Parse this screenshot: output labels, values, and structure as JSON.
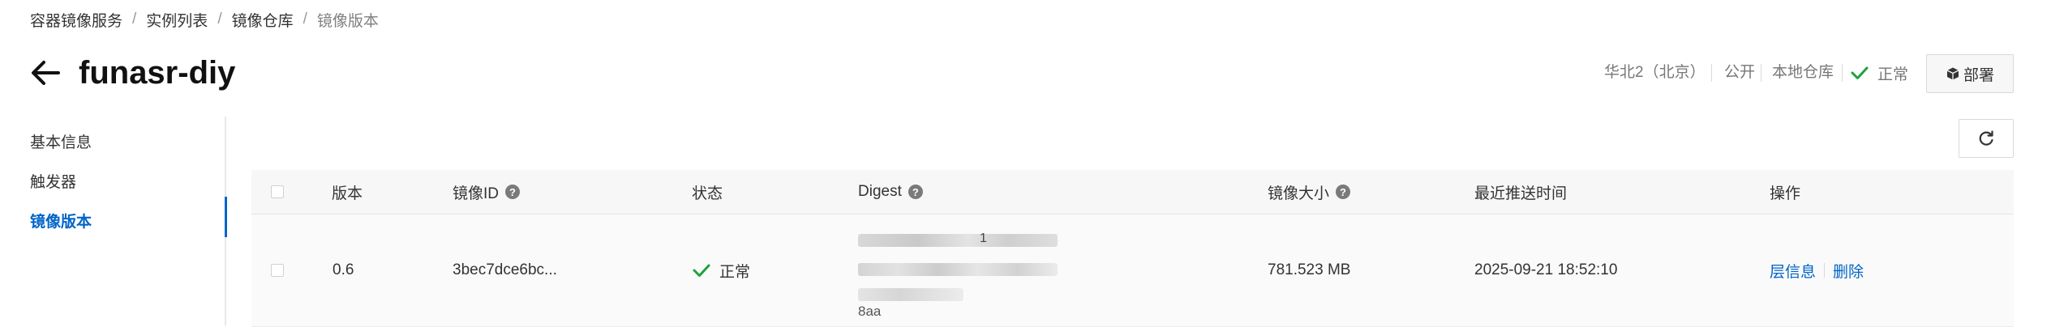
{
  "breadcrumb": {
    "items": [
      "容器镜像服务",
      "实例列表",
      "镜像仓库",
      "镜像版本"
    ],
    "separator": "/"
  },
  "header": {
    "title": "funasr-diy",
    "region": "华北2（北京）",
    "visibility": "公开",
    "repo_type": "本地仓库",
    "status": "正常",
    "deploy_label": "部署"
  },
  "side_nav": {
    "items": [
      {
        "label": "基本信息",
        "active": false
      },
      {
        "label": "触发器",
        "active": false
      },
      {
        "label": "镜像版本",
        "active": true
      }
    ]
  },
  "table": {
    "columns": {
      "version": "版本",
      "image_id": "镜像ID",
      "status": "状态",
      "digest": "Digest",
      "size": "镜像大小",
      "pushed": "最近推送时间",
      "actions": "操作"
    },
    "rows": [
      {
        "version": "0.6",
        "image_id": "3bec7dce6bc...",
        "status": "正常",
        "digest_visible_fragment": "1",
        "digest_tail": "8aa",
        "size": "781.523 MB",
        "pushed": "2025-09-21 18:52:10",
        "action_layers": "层信息",
        "action_delete": "删除"
      }
    ]
  },
  "colors": {
    "accent": "#0064c8",
    "success": "#1ea33b",
    "header_bg": "#f7f7f7"
  },
  "icons": {
    "back": "arrow-left-icon",
    "deploy": "cube-icon",
    "refresh": "refresh-icon",
    "check": "check-icon",
    "help": "question-circle-icon"
  }
}
